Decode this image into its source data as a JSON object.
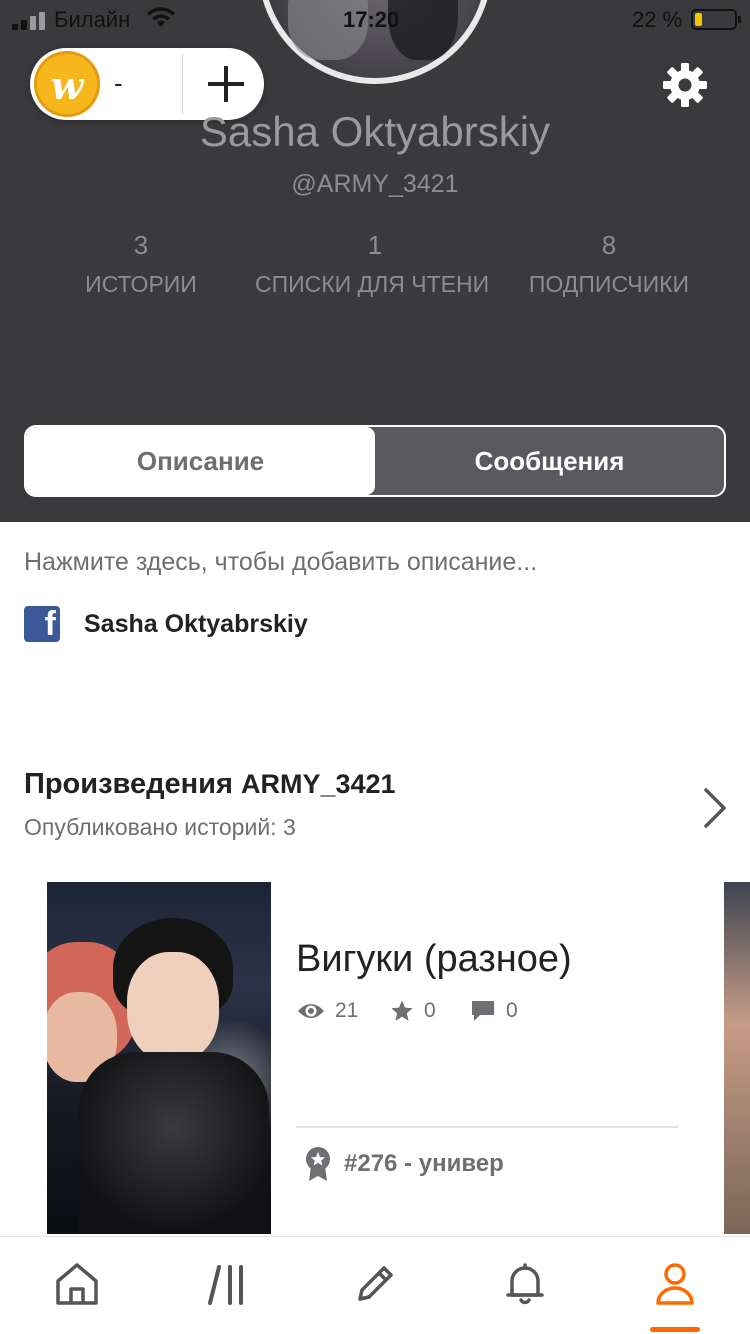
{
  "status_bar": {
    "carrier": "Билайн",
    "time": "17:20",
    "battery_percent": "22 %"
  },
  "coins": {
    "count": "-",
    "coin_icon": "wattpad-coin-icon",
    "coin_letter": "w",
    "add_icon": "plus-icon"
  },
  "settings_icon": "gear-icon",
  "profile": {
    "name": "Sasha Oktyabrskiy",
    "handle": "@ARMY_3421",
    "stats": [
      {
        "value": "3",
        "label": "ИСТОРИИ"
      },
      {
        "value": "1",
        "label": "СПИСКИ ДЛЯ ЧТЕНИЯ"
      },
      {
        "value": "8",
        "label": "ПОДПИСЧИКИ"
      }
    ]
  },
  "tabs": {
    "about": "Описание",
    "messages": "Сообщения",
    "active": "about"
  },
  "description": {
    "placeholder": "Нажмите здесь, чтобы добавить описание...",
    "facebook_letter": "f",
    "facebook_name": "Sasha Oktyabrskiy"
  },
  "works": {
    "title_prefix": "Произведения",
    "title_user": "ARMY_3421",
    "subtitle": "Опубликовано историй: 3",
    "stories": [
      {
        "title": "Вигуки (разное)",
        "reads": "21",
        "votes": "0",
        "comments": "0",
        "rank": "#276 - универ"
      }
    ]
  },
  "bottom_nav": {
    "items": [
      "home-icon",
      "library-icon",
      "write-icon",
      "notifications-icon",
      "profile-icon"
    ],
    "active": "profile-icon"
  },
  "colors": {
    "header_bg": "#3a393c",
    "accent": "#ff6a00",
    "facebook": "#3b5998",
    "coin": "#f6b71d"
  }
}
